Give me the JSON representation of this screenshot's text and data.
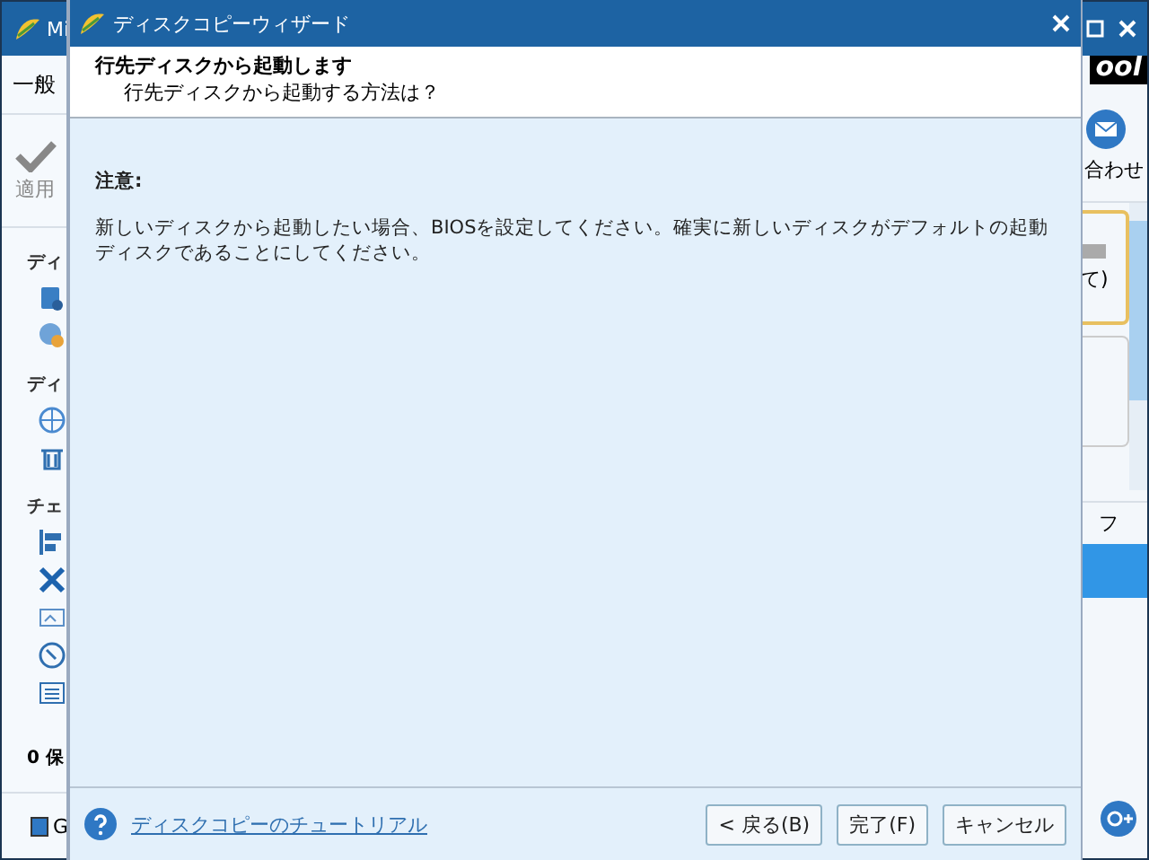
{
  "background_app": {
    "title": "Mi",
    "menu": "一般",
    "apply_label": "適用",
    "logo": "ool",
    "contact_label": "合わせ",
    "sidebar_sections": [
      {
        "heading": "ディ"
      },
      {
        "heading": "ディ"
      },
      {
        "heading": "チェ"
      }
    ],
    "status": "0 保",
    "legend": "G",
    "card_text": "て)",
    "column_label": "フ"
  },
  "dialog": {
    "title": "ディスクコピーウィザード",
    "header_title": "行先ディスクから起動します",
    "header_subtitle": "行先ディスクから起動する方法は？",
    "note_label": "注意:",
    "note_text": "新しいディスクから起動したい場合、BIOSを設定してください。確実に新しいディスクがデフォルトの起動ディスクであることにしてください。",
    "tutorial_link": "ディスクコピーのチュートリアル",
    "buttons": [
      {
        "label": "< 戻る(B)"
      },
      {
        "label": "完了(F)"
      },
      {
        "label": "キャンセル"
      }
    ]
  }
}
